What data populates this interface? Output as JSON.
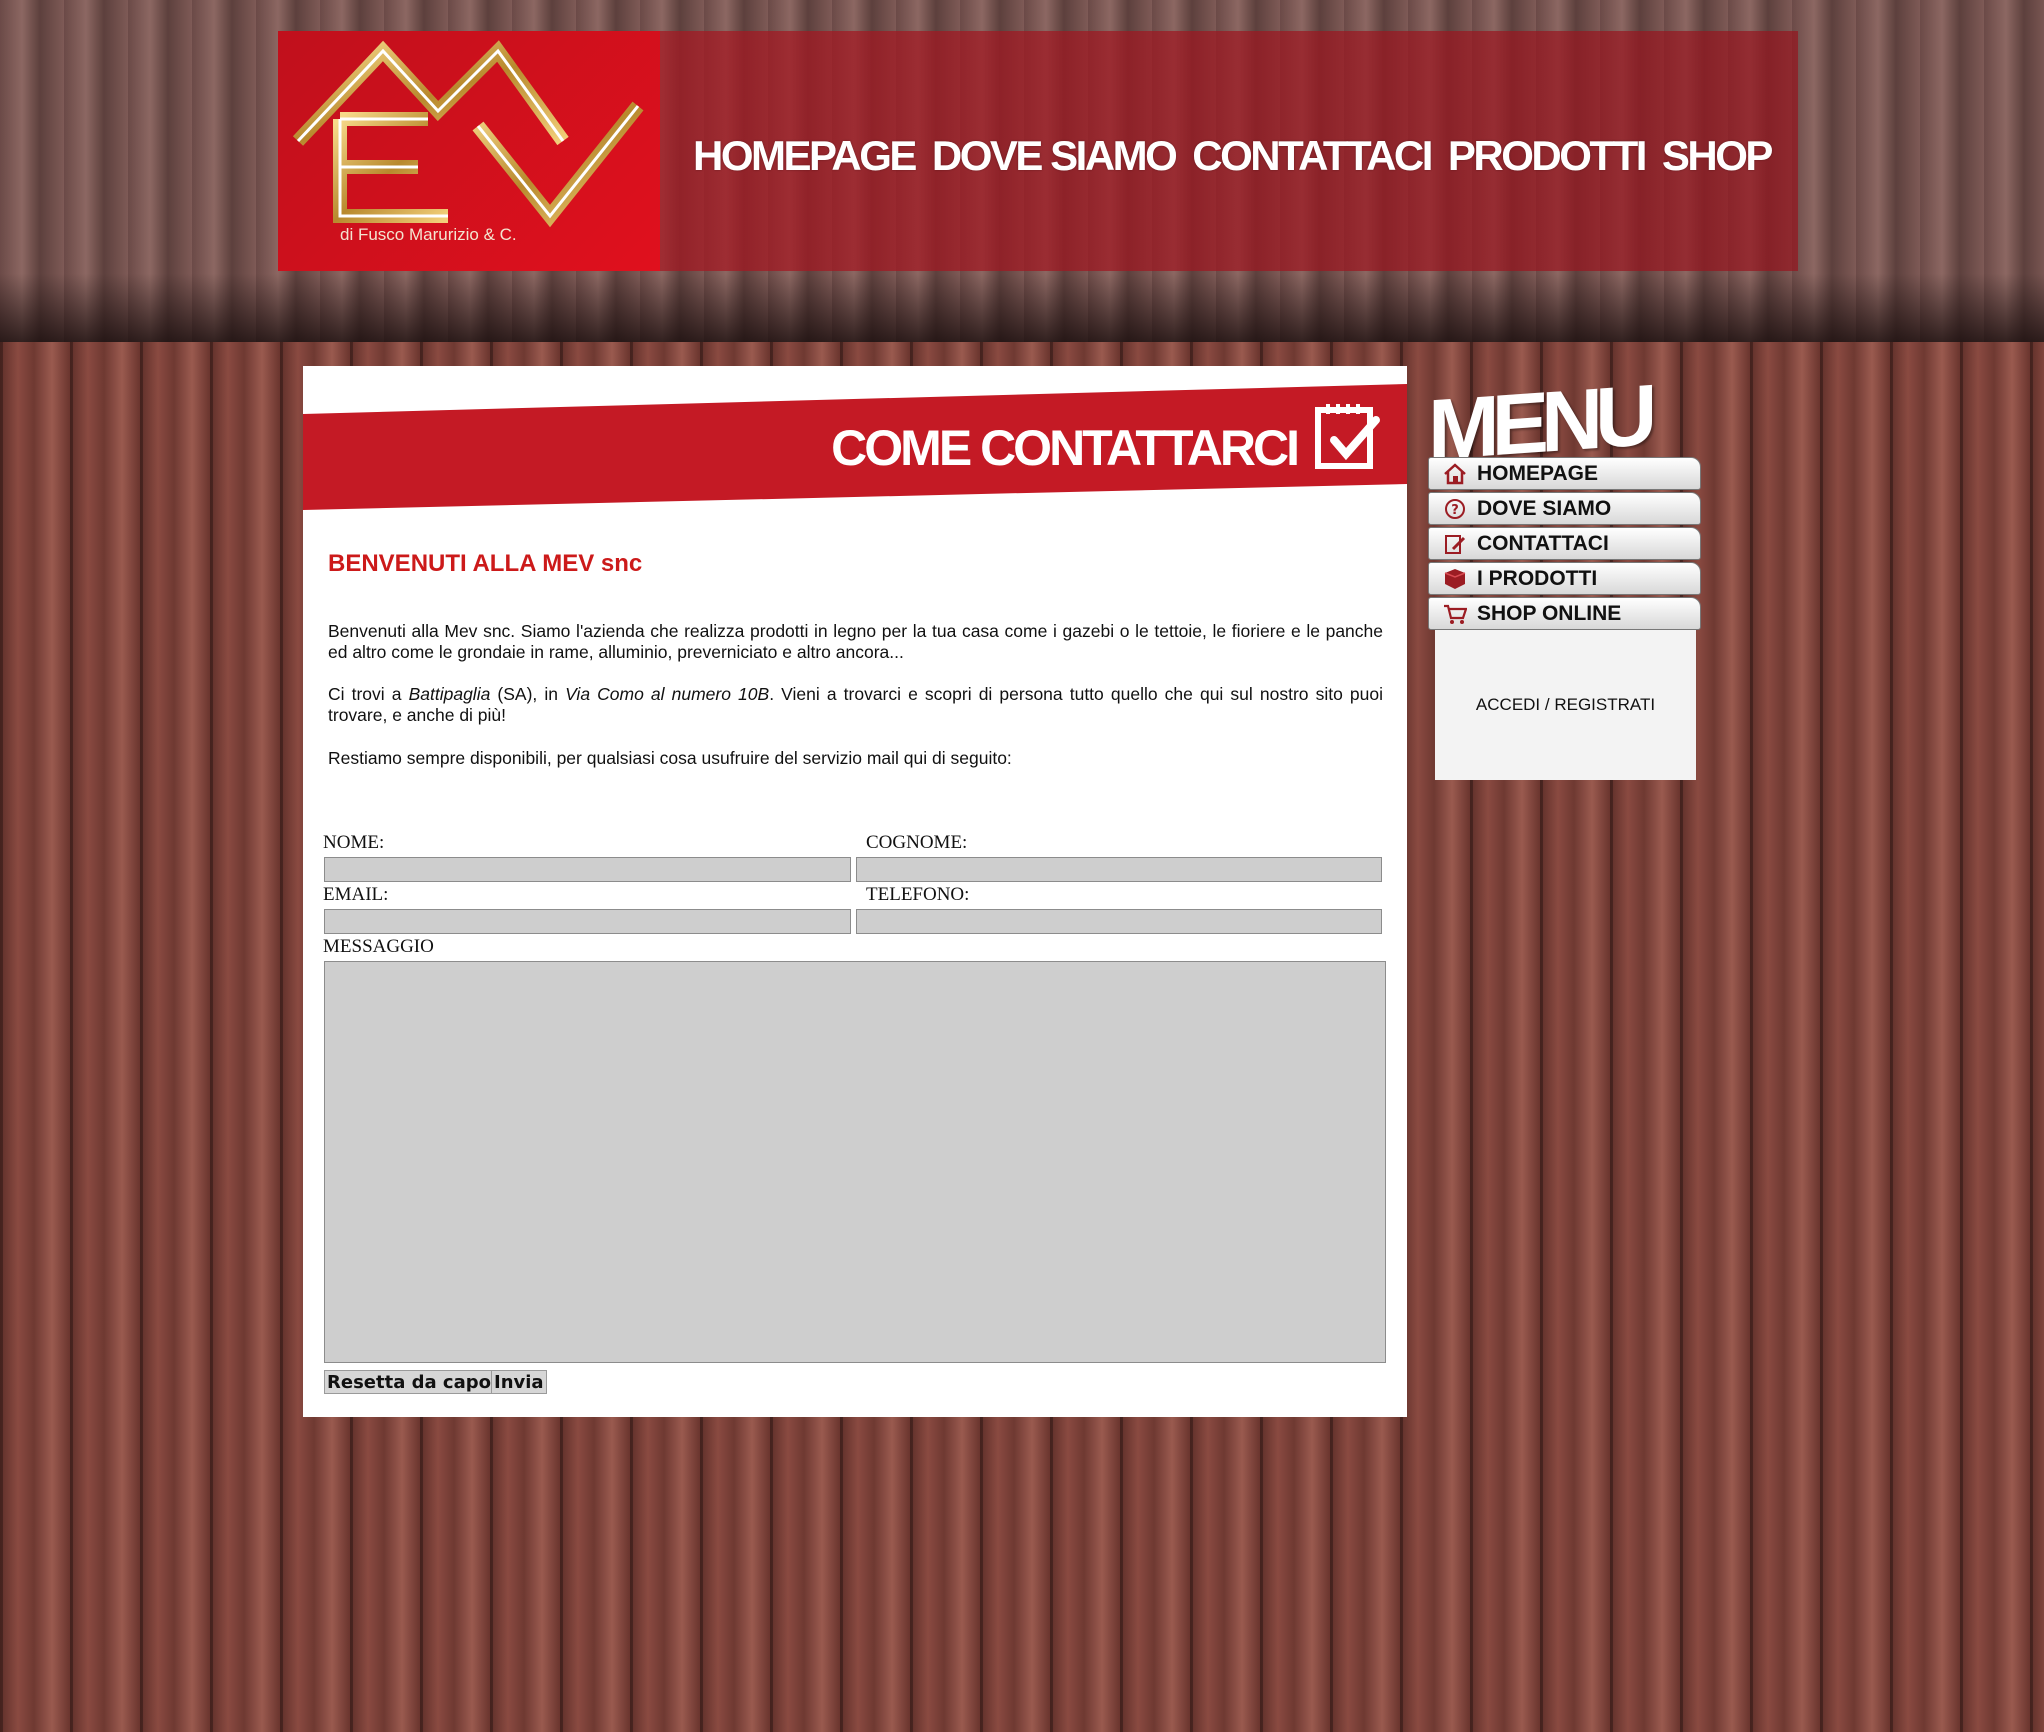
{
  "header": {
    "logo_text": "MEV snc",
    "logo_subtitle": "di Fusco Marurizio & C.",
    "nav": [
      "HOMEPAGE",
      "DOVE SIAMO",
      "CONTATTACI",
      "PRODOTTI",
      "SHOP"
    ]
  },
  "banner": {
    "title": "COME CONTATTARCI",
    "icon": "checklist-icon"
  },
  "content": {
    "welcome_title": "BENVENUTI ALLA MEV snc",
    "para1": "Benvenuti alla Mev snc. Siamo l'azienda che realizza prodotti in legno per la tua casa come i gazebi o le tettoie, le fioriere e le panche ed altro come le grondaie in rame, alluminio, preverniciato e altro ancora...",
    "para2": {
      "t1": "Ci trovi a ",
      "city": "Battipaglia",
      "t2": " (SA), in ",
      "street": "Via Como al numero 10B",
      "t3": ". Vieni a trovarci e scopri di persona tutto quello che qui sul nostro sito puoi trovare, e anche di più!"
    },
    "para3": "Restiamo sempre disponibili, per qualsiasi cosa usufruire del servizio mail qui di seguito:"
  },
  "form": {
    "nome_label": "NOME:",
    "cognome_label": "COGNOME:",
    "email_label": "EMAIL:",
    "telefono_label": "TELEFONO:",
    "messaggio_label": "MESSAGGIO",
    "nome_value": "",
    "cognome_value": "",
    "email_value": "",
    "telefono_value": "",
    "messaggio_value": "",
    "reset_label": "Resetta da capo",
    "submit_label": "Invia"
  },
  "side_menu": {
    "title": "MENU",
    "items": [
      {
        "label": "HOMEPAGE",
        "icon": "home-icon"
      },
      {
        "label": "DOVE SIAMO",
        "icon": "question-icon"
      },
      {
        "label": "CONTATTACI",
        "icon": "edit-icon"
      },
      {
        "label": "I PRODOTTI",
        "icon": "box-icon"
      },
      {
        "label": "SHOP ONLINE",
        "icon": "cart-icon"
      }
    ],
    "login_label": "ACCEDI / REGISTRATI"
  },
  "colors": {
    "brand_red": "#c41a25",
    "title_red": "#cc1a1a",
    "field_gray": "#cecece"
  }
}
